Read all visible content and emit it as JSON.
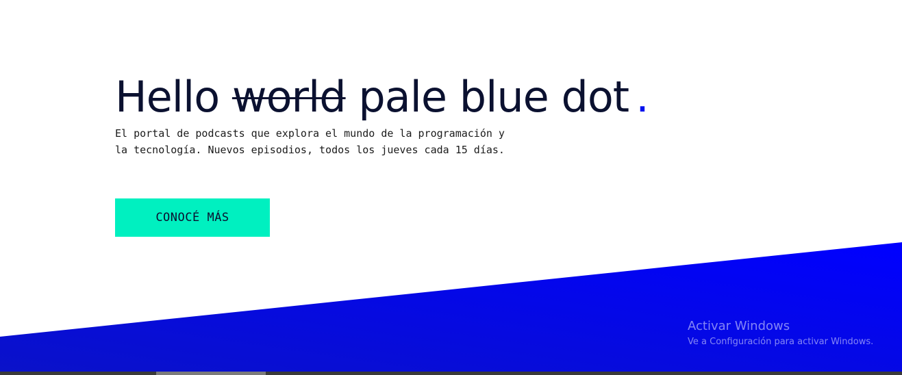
{
  "hero": {
    "headline": {
      "word1": "Hello",
      "struck": "world",
      "word2": "pale blue dot",
      "dot": "."
    },
    "subtitle_line1": "El portal de podcasts que explora el mundo de la programación y",
    "subtitle_line2": "la tecnología. Nuevos episodios, todos los jueves cada 15 días.",
    "cta_label": "CONOCÉ MÁS"
  },
  "windows_watermark": {
    "title": "Activar Windows",
    "subtitle": "Ve a Configuración para activar Windows."
  },
  "colors": {
    "accent_blue": "#0011ee",
    "cta_bg": "#00f0c0",
    "text_dark": "#0b1130",
    "wedge_start": "#0a12c8",
    "wedge_end": "#0000ff"
  }
}
